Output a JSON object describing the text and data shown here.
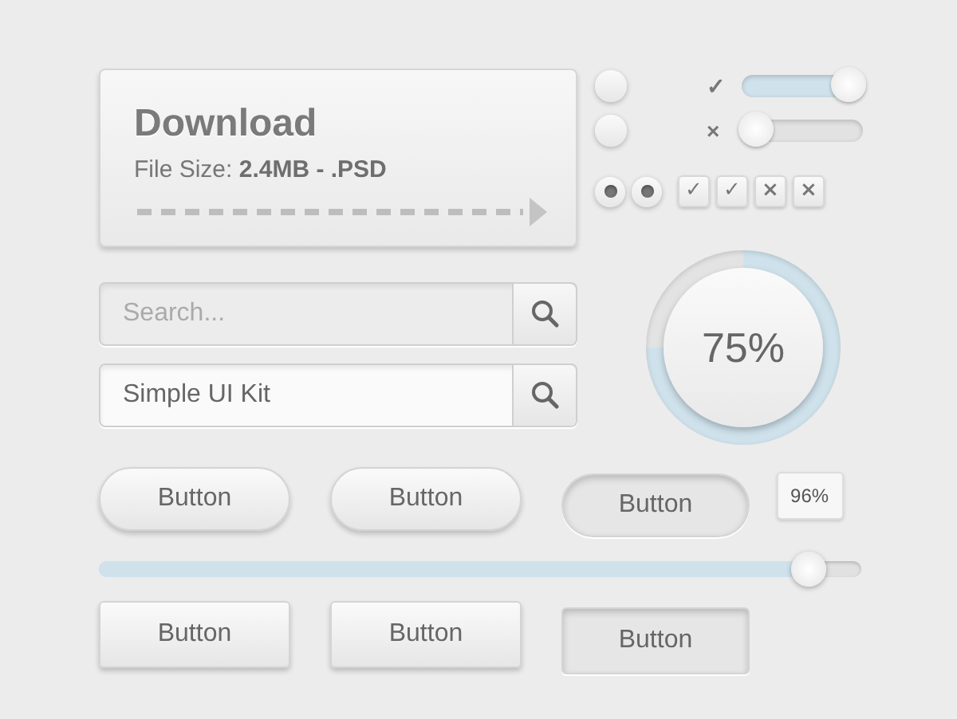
{
  "download": {
    "title": "Download",
    "size_label": "File Size:",
    "size_value": "2.4MB - .PSD"
  },
  "search_fields": [
    {
      "placeholder": "Search..."
    },
    {
      "value": "Simple UI Kit"
    }
  ],
  "radios": [
    {
      "selected": false
    },
    {
      "selected": false
    },
    {
      "selected": true
    },
    {
      "selected": true
    }
  ],
  "toggles": [
    {
      "label": "✓",
      "on": true
    },
    {
      "label": "×",
      "on": false
    }
  ],
  "icon_buttons": [
    {
      "glyph": "✓"
    },
    {
      "glyph": "✓"
    },
    {
      "glyph": "×"
    },
    {
      "glyph": "×"
    }
  ],
  "progress": {
    "text": "75%"
  },
  "buttons_row_1": [
    {
      "label": "Button",
      "pressed": false
    },
    {
      "label": "Button",
      "pressed": false
    },
    {
      "label": "Button",
      "pressed": true
    }
  ],
  "slider": {
    "level": 0.93,
    "tooltip": "96%"
  },
  "buttons_row_2": [
    {
      "label": "Button",
      "pressed": false
    },
    {
      "label": "Button",
      "pressed": false
    },
    {
      "label": "Button",
      "pressed": true
    }
  ]
}
